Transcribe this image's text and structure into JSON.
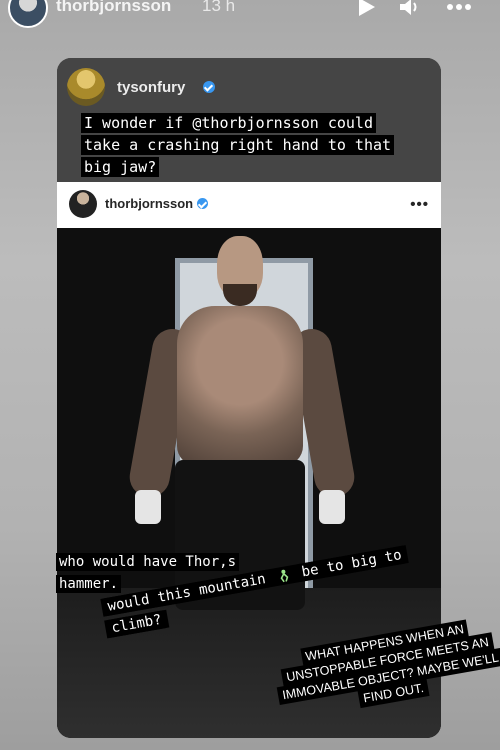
{
  "story": {
    "username": "thorbjornsson",
    "time": "13 h"
  },
  "reposted": {
    "username": "tysonfury",
    "quote": "I wonder if @thorbjornsson could take a crashing right hand to that big jaw?"
  },
  "post": {
    "username": "thorbjornsson",
    "more": "•••"
  },
  "captions": {
    "line1": "who would have Thor,s hammer.",
    "line2a": "would this mountain",
    "line2b": "be to big to climb?",
    "force": "WHAT HAPPENS WHEN AN UNSTOPPABLE FORCE MEETS AN IMMOVABLE OBJECT? MAYBE WE'LL FIND OUT."
  },
  "icons": {
    "play": "play-icon",
    "volume": "volume-icon",
    "more": "more-icon",
    "verified": "verified-icon",
    "climber": "climber-icon"
  },
  "colors": {
    "verified": "#3897f0",
    "text_bg": "#000000"
  }
}
